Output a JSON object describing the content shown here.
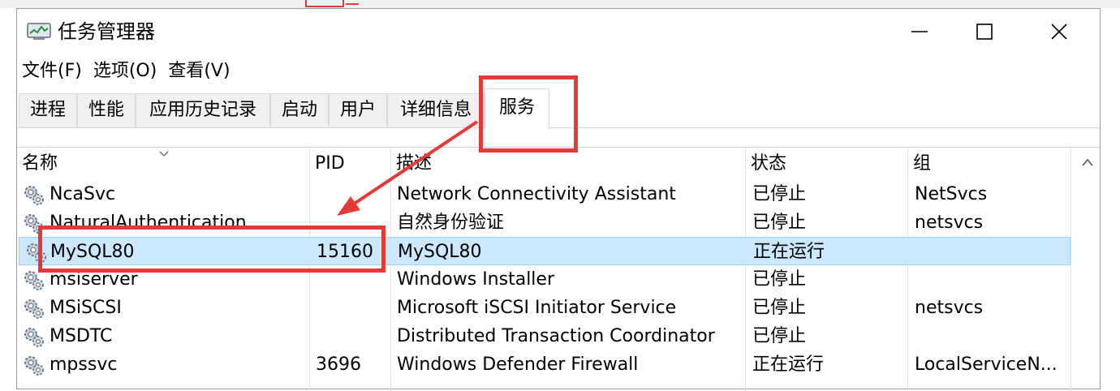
{
  "window": {
    "title": "任务管理器",
    "controls": {
      "minimize": "minimize",
      "maximize": "maximize",
      "close": "close"
    }
  },
  "menu": [
    "文件(F)",
    "选项(O)",
    "查看(V)"
  ],
  "tabs": [
    {
      "label": "进程"
    },
    {
      "label": "性能"
    },
    {
      "label": "应用历史记录"
    },
    {
      "label": "启动"
    },
    {
      "label": "用户"
    },
    {
      "label": "详细信息"
    },
    {
      "label": "服务"
    }
  ],
  "active_tab": "服务",
  "columns": [
    "名称",
    "PID",
    "描述",
    "状态",
    "组"
  ],
  "services": [
    {
      "name": "NcaSvc",
      "pid": "",
      "description": "Network Connectivity Assistant",
      "status": "已停止",
      "group": "NetSvcs"
    },
    {
      "name": "NaturalAuthentication",
      "pid": "",
      "description": "自然身份验证",
      "status": "已停止",
      "group": "netsvcs"
    },
    {
      "name": "MySQL80",
      "pid": "15160",
      "description": "MySQL80",
      "status": "正在运行",
      "group": "",
      "selected": true
    },
    {
      "name": "msiserver",
      "pid": "",
      "description": "Windows Installer",
      "status": "已停止",
      "group": ""
    },
    {
      "name": "MSiSCSI",
      "pid": "",
      "description": "Microsoft iSCSI Initiator Service",
      "status": "已停止",
      "group": "netsvcs"
    },
    {
      "name": "MSDTC",
      "pid": "",
      "description": "Distributed Transaction Coordinator",
      "status": "已停止",
      "group": ""
    },
    {
      "name": "mpssvc",
      "pid": "3696",
      "description": "Windows Defender Firewall",
      "status": "正在运行",
      "group": "LocalServiceN..."
    }
  ],
  "colors": {
    "annotation": "#e53935",
    "selection": "#cce8ff",
    "selection_border": "#99d1ff"
  },
  "icons": {
    "app": "task-manager-icon",
    "service": "service-gear-icon"
  }
}
